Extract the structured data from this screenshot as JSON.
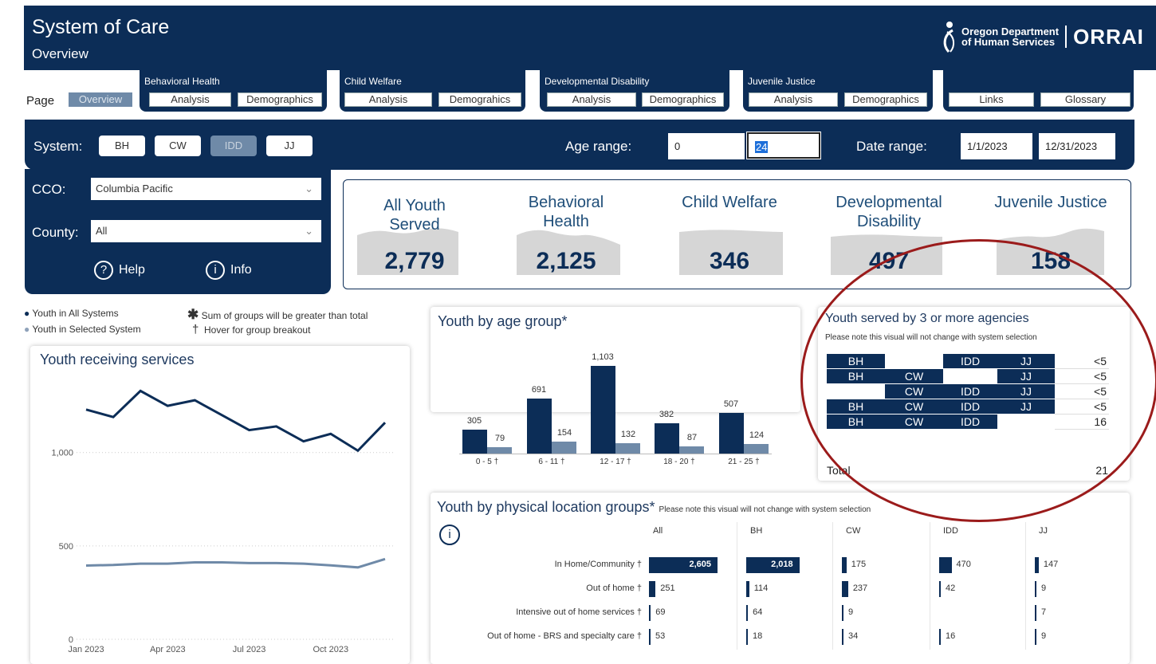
{
  "header": {
    "title": "System of Care",
    "subtitle": "Overview",
    "org_line1": "Oregon Department",
    "org_line2": "of Human Services",
    "org_short": "ORRAI"
  },
  "nav": {
    "page_label": "Page",
    "overview": "Overview",
    "groups": [
      {
        "title": "Behavioral Health",
        "a": "Analysis",
        "b": "Demographics"
      },
      {
        "title": "Child Welfare",
        "a": "Analysis",
        "b": "Demograhics"
      },
      {
        "title": "Developmental Disability",
        "a": "Analysis",
        "b": "Demographics"
      },
      {
        "title": "Juvenile Justice",
        "a": "Analysis",
        "b": "Demographics"
      }
    ],
    "links": "Links",
    "glossary": "Glossary"
  },
  "filters": {
    "system_label": "System:",
    "systems": [
      "BH",
      "CW",
      "IDD",
      "JJ"
    ],
    "selected_system": "IDD",
    "age_label": "Age range:",
    "age_min": "0",
    "age_max": "24",
    "date_label": "Date range:",
    "date_from": "1/1/2023",
    "date_to": "12/31/2023",
    "cco_label": "CCO:",
    "cco_value": "Columbia Pacific",
    "county_label": "County:",
    "county_value": "All",
    "help": "Help",
    "info": "Info"
  },
  "kpis": [
    {
      "label1": "All Youth",
      "label2": "Served",
      "value": "2,779"
    },
    {
      "label1": "Behavioral",
      "label2": "Health",
      "value": "2,125"
    },
    {
      "label1": "Child Welfare",
      "label2": "",
      "value": "346"
    },
    {
      "label1": "Developmental",
      "label2": "Disability",
      "value": "497"
    },
    {
      "label1": "Juvenile Justice",
      "label2": "",
      "value": "158"
    }
  ],
  "legend": {
    "all": "Youth in All Systems",
    "selected": "Youth in Selected System",
    "sum_note": "Sum of groups will be greater than total",
    "hover_note": "Hover for group breakout"
  },
  "colors": {
    "navy": "#0c2d57",
    "slate": "#6f8aa8",
    "circle": "#9b1b1b"
  },
  "line_chart": {
    "title": "Youth receiving services",
    "x_labels": [
      "Jan 2023",
      "Apr 2023",
      "Jul 2023",
      "Oct 2023"
    ],
    "y_labels": [
      "1,000",
      "500",
      "0"
    ]
  },
  "chart_data": [
    {
      "type": "line",
      "title": "Youth receiving services",
      "x": [
        "Jan 2023",
        "Feb 2023",
        "Mar 2023",
        "Apr 2023",
        "May 2023",
        "Jun 2023",
        "Jul 2023",
        "Aug 2023",
        "Sep 2023",
        "Oct 2023",
        "Nov 2023",
        "Dec 2023"
      ],
      "ylim": [
        0,
        1400
      ],
      "series": [
        {
          "values": [
            1230,
            1190,
            1330,
            1250,
            1280,
            1200,
            1120,
            1140,
            1060,
            1100,
            1010,
            1160
          ]
        },
        {
          "values": [
            395,
            398,
            405,
            405,
            412,
            412,
            408,
            408,
            405,
            396,
            385,
            430
          ]
        }
      ]
    },
    {
      "type": "bar",
      "title": "Youth by age group*",
      "categories": [
        "0 - 5 †",
        "6 - 11 †",
        "12 - 17 †",
        "18 - 20 †",
        "21 - 25 †"
      ],
      "series": [
        {
          "values": [
            305,
            691,
            1103,
            382,
            507
          ]
        },
        {
          "values": [
            79,
            154,
            132,
            87,
            124
          ]
        }
      ]
    },
    {
      "type": "bar",
      "title": "Youth by physical location groups*",
      "categories": [
        "In Home/Community †",
        "Out of home †",
        "Intensive out of home services †",
        "Out of home - BRS and specialty care †"
      ],
      "series": [
        {
          "name": "All",
          "values": [
            2605,
            251,
            69,
            53
          ]
        },
        {
          "name": "BH",
          "values": [
            2018,
            114,
            64,
            18
          ]
        },
        {
          "name": "CW",
          "values": [
            175,
            237,
            9,
            34
          ]
        },
        {
          "name": "IDD",
          "values": [
            470,
            42,
            null,
            16
          ]
        },
        {
          "name": "JJ",
          "values": [
            147,
            9,
            7,
            9
          ]
        }
      ]
    }
  ],
  "age_chart": {
    "title": "Youth by age group*",
    "all": [
      "305",
      "691",
      "1,103",
      "382",
      "507"
    ],
    "sel": [
      "79",
      "154",
      "132",
      "87",
      "124"
    ],
    "cats": [
      "0 - 5 †",
      "6 - 11 †",
      "12 - 17 †",
      "18 - 20 †",
      "21 - 25 †"
    ]
  },
  "multi_agency": {
    "title": "Youth served by 3 or more agencies",
    "note": "Please note this visual will not change with system selection",
    "rows": [
      {
        "bh": "BH",
        "cw": "",
        "idd": "IDD",
        "jj": "JJ",
        "count": "<5"
      },
      {
        "bh": "BH",
        "cw": "CW",
        "idd": "",
        "jj": "JJ",
        "count": "<5"
      },
      {
        "bh": "",
        "cw": "CW",
        "idd": "IDD",
        "jj": "JJ",
        "count": "<5"
      },
      {
        "bh": "BH",
        "cw": "CW",
        "idd": "IDD",
        "jj": "JJ",
        "count": "<5"
      },
      {
        "bh": "BH",
        "cw": "CW",
        "idd": "IDD",
        "jj": "",
        "count": "16"
      }
    ],
    "total_label": "Total",
    "total": "21"
  },
  "location_chart": {
    "title": "Youth by physical location groups*",
    "note": "Please note this visual will not change with system selection",
    "columns": [
      "All",
      "BH",
      "CW",
      "IDD",
      "JJ"
    ],
    "rows": [
      "In Home/Community †",
      "Out of home †",
      "Intensive out of home services †",
      "Out of home - BRS and specialty care †"
    ],
    "values": [
      [
        "2,605",
        "2,018",
        "175",
        "470",
        "147"
      ],
      [
        "251",
        "114",
        "237",
        "42",
        "9"
      ],
      [
        "69",
        "64",
        "9",
        "",
        "7"
      ],
      [
        "53",
        "18",
        "34",
        "16",
        "9"
      ]
    ]
  }
}
